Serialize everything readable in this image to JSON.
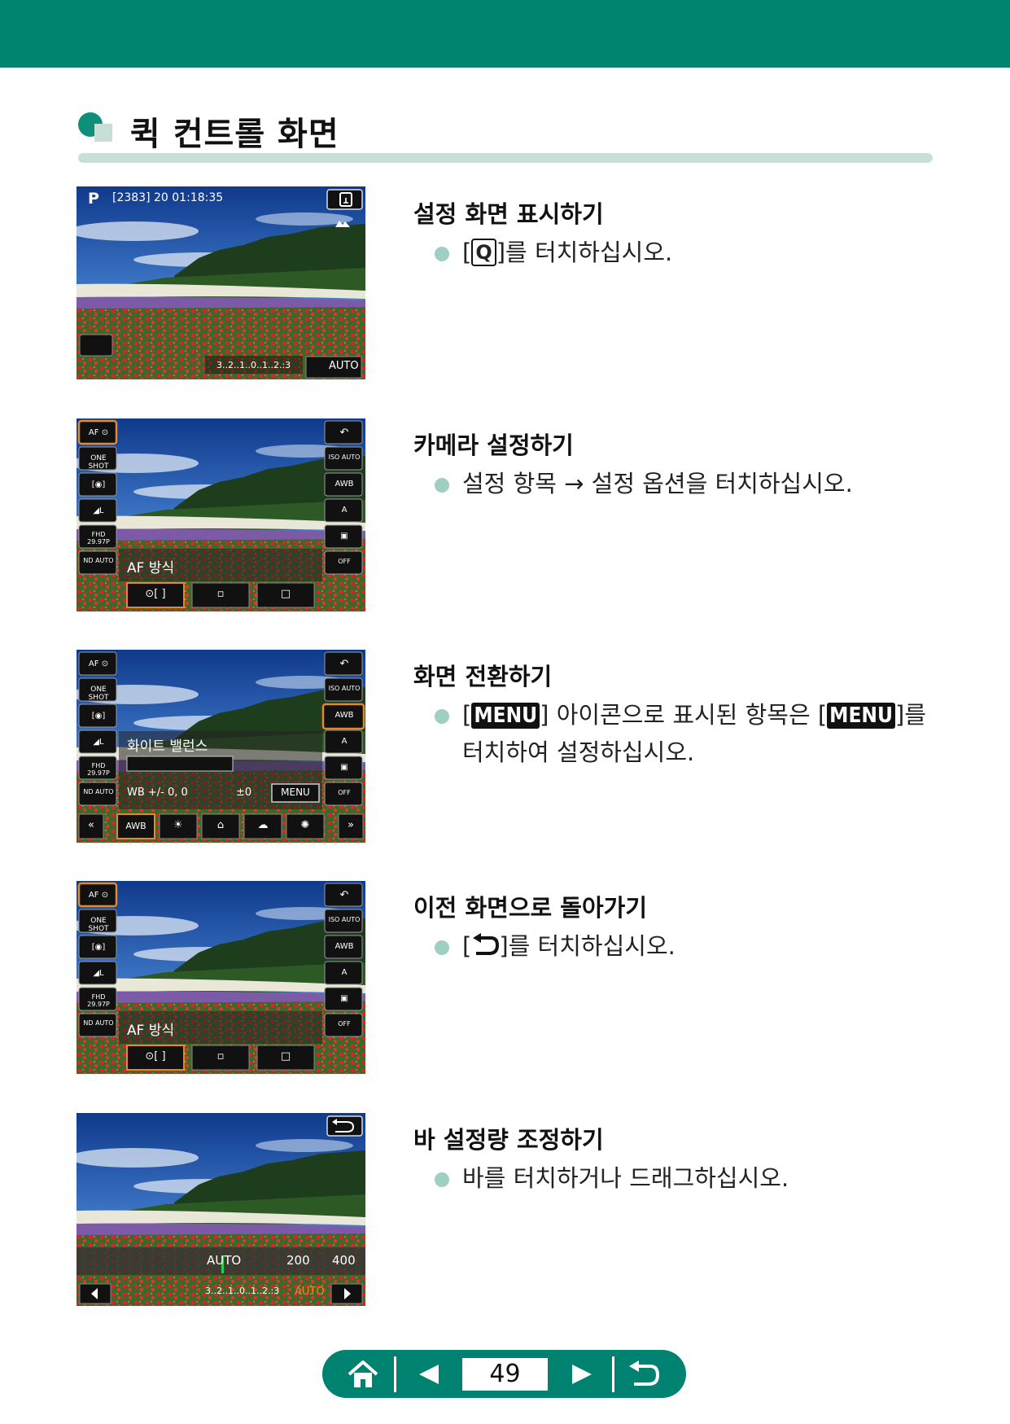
{
  "section": {
    "title": "퀵 컨트롤 화면"
  },
  "rows": [
    {
      "title": "설정 화면 표시하기",
      "text_pre": "[",
      "key": "Q",
      "text_post": "]를 터치하십시오.",
      "screen": {
        "mode": "P",
        "info": "[2383] 20 01:18:35",
        "corner_key": "Q",
        "exposure_scale": "3..2..1..0..1..2.:3",
        "iso": "AUTO"
      }
    },
    {
      "title": "카메라 설정하기",
      "text": "설정 항목 → 설정 옵션을 터치하십시오.",
      "screen": {
        "left_items": [
          "AF ⊙",
          "ONE SHOT",
          "[◉]",
          "◢L",
          "FHD 29.97P",
          "ND AUTO"
        ],
        "right_items": [
          "↶",
          "ISO AUTO",
          "AWB",
          "A",
          "▣",
          "OFF"
        ],
        "label": "AF 방식",
        "options": [
          "⊙[ ]",
          "▫",
          "□"
        ]
      }
    },
    {
      "title": "화면 전환하기",
      "text_pre": "[",
      "key": "MENU",
      "text_mid": "] 아이콘으로 표시된 항목은 [",
      "key2": "MENU",
      "text_post": "]를",
      "text_line2": "터치하여 설정하십시오.",
      "screen": {
        "left_items": [
          "AF ⊙",
          "ONE SHOT",
          "[◉]",
          "◢L",
          "FHD 29.97P",
          "ND AUTO"
        ],
        "right_items": [
          "↶",
          "ISO AUTO",
          "AWB",
          "A",
          "▣",
          "OFF"
        ],
        "label": "화이트 밸런스",
        "wb_shift": "WB +/-  0, 0",
        "bracket": "±0",
        "menu_key": "MENU",
        "options": [
          "«",
          "AWB",
          "☀",
          "⌂",
          "☁",
          "✺",
          "»"
        ]
      }
    },
    {
      "title": "이전 화면으로 돌아가기",
      "text_pre": "[",
      "text_post": "]를 터치하십시오.",
      "screen": {
        "left_items": [
          "AF ⊙",
          "ONE SHOT",
          "[◉]",
          "◢L",
          "FHD 29.97P",
          "ND AUTO"
        ],
        "right_items": [
          "↶",
          "ISO AUTO",
          "AWB",
          "A",
          "▣",
          "OFF"
        ],
        "label": "AF 방식",
        "options": [
          "⊙[ ]",
          "▫",
          "□"
        ]
      }
    },
    {
      "title": "바 설정량 조정하기",
      "text": "바를 터치하거나 드래그하십시오.",
      "screen": {
        "bar_labels": [
          "AUTO",
          "200",
          "400"
        ],
        "exposure_scale": "3..2..1..0..1..2.:3",
        "iso": "AUTO"
      }
    }
  ],
  "nav": {
    "page": "49"
  },
  "colors": {
    "brand": "#008270",
    "rule": "#c6e0d7",
    "bullet": "#9fcfc2",
    "accent": "#e08a2a"
  }
}
